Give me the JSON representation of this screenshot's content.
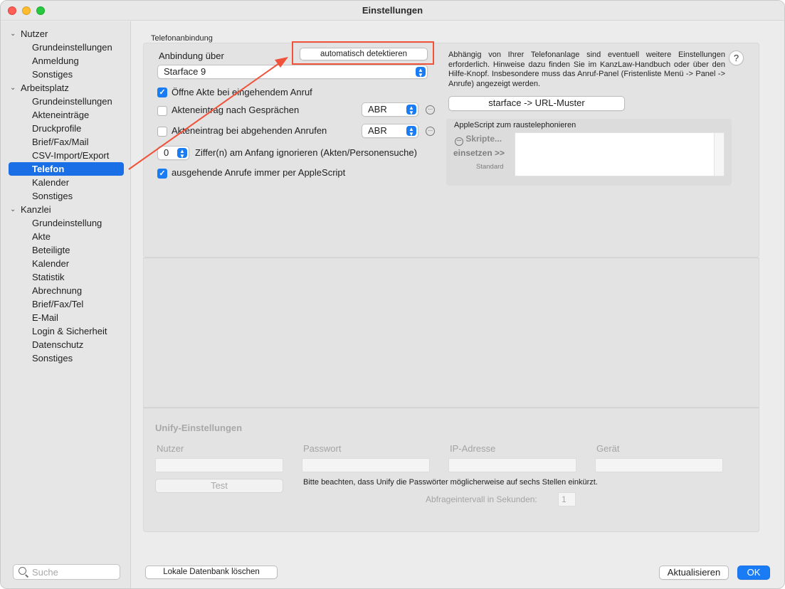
{
  "window": {
    "title": "Einstellungen"
  },
  "sidebar": {
    "groups": [
      {
        "label": "Nutzer",
        "items": [
          "Grundeinstellungen",
          "Anmeldung",
          "Sonstiges"
        ]
      },
      {
        "label": "Arbeitsplatz",
        "items": [
          "Grundeinstellungen",
          "Akteneinträge",
          "Druckprofile",
          "Brief/Fax/Mail",
          "CSV-Import/Export",
          "Telefon",
          "Kalender",
          "Sonstiges"
        ]
      },
      {
        "label": "Kanzlei",
        "items": [
          "Grundeinstellung",
          "Akte",
          "Beteiligte",
          "Kalender",
          "Statistik",
          "Abrechnung",
          "Brief/Fax/Tel",
          "E-Mail",
          "Login & Sicherheit",
          "Datenschutz",
          "Sonstiges"
        ]
      }
    ],
    "selected": "Telefon",
    "search_placeholder": "Suche"
  },
  "telefon": {
    "group_label": "Telefonanbindung",
    "anbindung_label": "Anbindung über",
    "auto_detect_button": "automatisch detektieren",
    "anbindung_value": "Starface 9",
    "hint_text": "Abhängig von Ihrer Telefonanlage sind eventuell weitere Einstellungen erforderlich. Hinweise dazu finden Sie im KanzLaw-Handbuch oder über den Hilfe-Knopf. Insbesondere muss das Anruf-Panel (Fristenliste Menü -> Panel -> Anrufe) angezeigt werden.",
    "help_button": "?",
    "url_pattern_button": "starface -> URL-Muster",
    "open_file_label": "Öffne Akte bei eingehendem Anruf",
    "open_file_checked": true,
    "entry_after_calls_label": "Akteneintrag nach Gesprächen",
    "entry_after_calls_checked": false,
    "entry_after_calls_value": "ABR",
    "entry_outgoing_label": "Akteneintrag bei abgehenden Anrufen",
    "entry_outgoing_checked": false,
    "entry_outgoing_value": "ABR",
    "ignore_digits_value": "0",
    "ignore_digits_label": "Ziffer(n) am Anfang ignorieren (Akten/Personensuche)",
    "applescript_label": "ausgehende Anrufe immer per AppleScript",
    "applescript_checked": true,
    "applescript_box_label": "AppleScript zum raustelephonieren",
    "scripts_button": "Skripte...",
    "insert_button": "einsetzen >>",
    "standard_label": "Standard"
  },
  "unify": {
    "title": "Unify-Einstellungen",
    "user_label": "Nutzer",
    "password_label": "Passwort",
    "ip_label": "IP-Adresse",
    "device_label": "Gerät",
    "test_button": "Test",
    "note": "Bitte beachten, dass Unify die Passwörter möglicherweise auf sechs Stellen einkürzt.",
    "interval_label": "Abfrageintervall in Sekunden:",
    "interval_value": "1"
  },
  "footer": {
    "delete_db_button": "Lokale Datenbank löschen",
    "update_button": "Aktualisieren",
    "ok_button": "OK"
  },
  "colors": {
    "accent": "#1a7cf5",
    "annotation": "#f0533a"
  }
}
